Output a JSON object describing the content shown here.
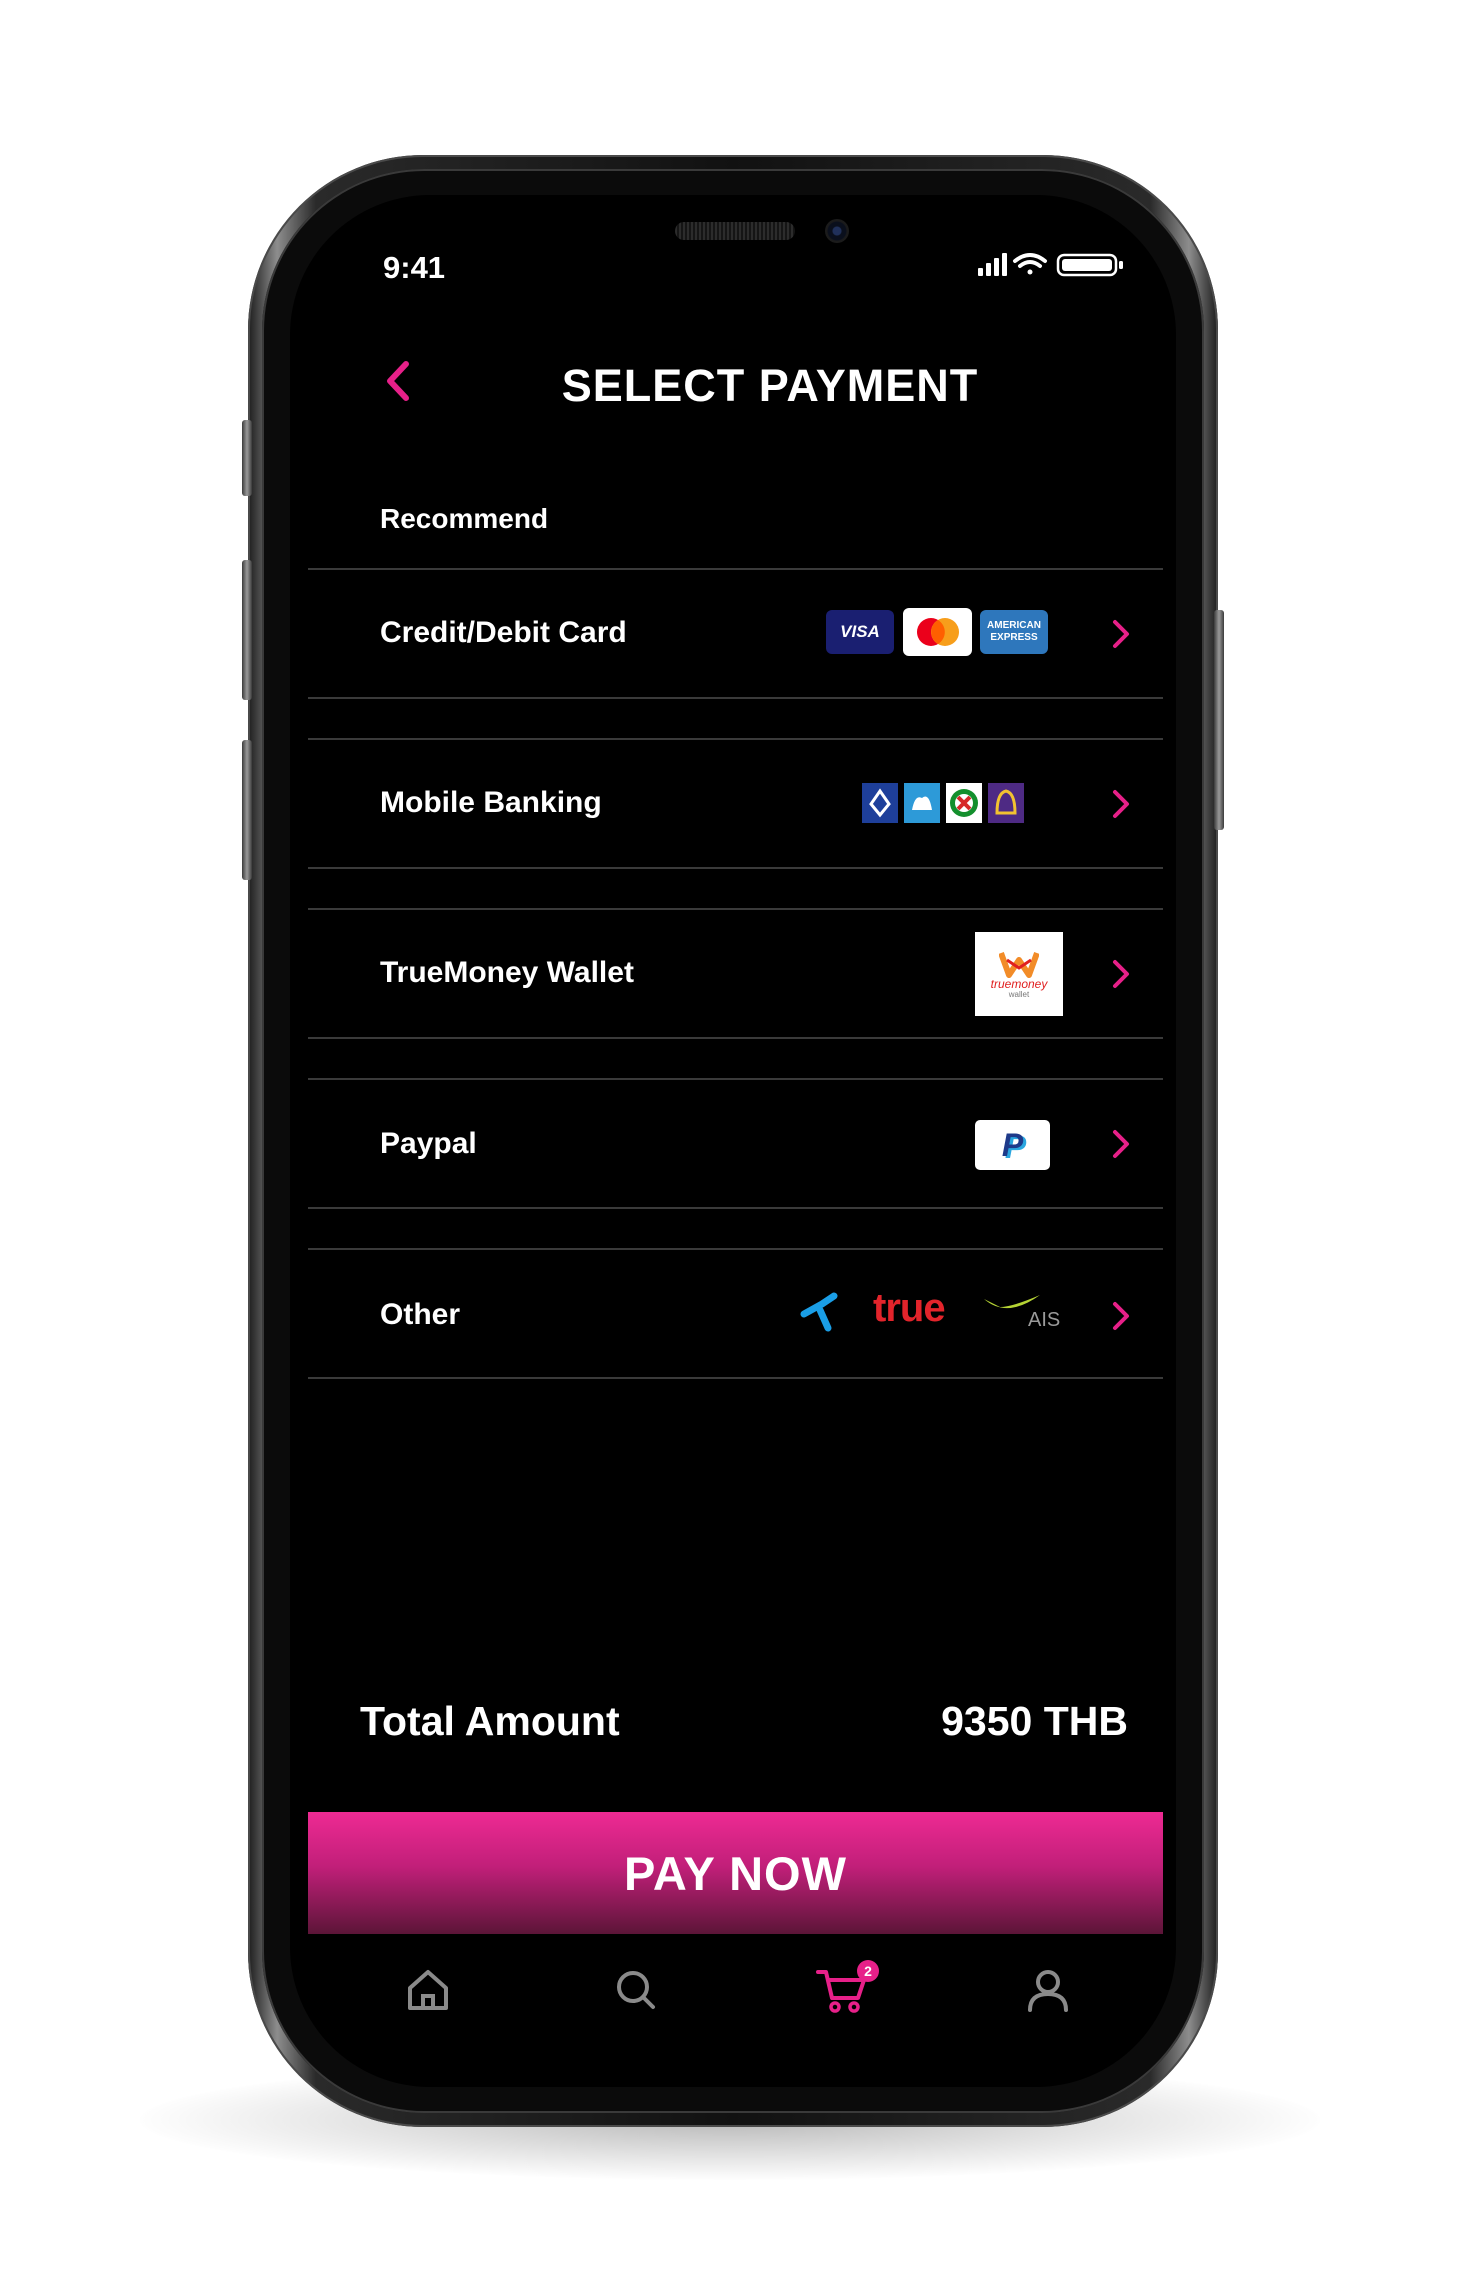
{
  "status_bar": {
    "time": "9:41"
  },
  "header": {
    "title": "SELECT PAYMENT",
    "back_icon": "chevron-left-icon"
  },
  "section": {
    "label": "Recommend"
  },
  "payment_methods": [
    {
      "label": "Credit/Debit Card",
      "logos": [
        "VISA",
        "mastercard",
        "AMERICAN EXPRESS"
      ]
    },
    {
      "label": "Mobile Banking",
      "logos": [
        "bangkok-bank-icon",
        "krungsri-icon",
        "kasikorn-icon",
        "scb-icon"
      ]
    },
    {
      "label": "TrueMoney Wallet",
      "logos": [
        "truemoney wallet"
      ]
    },
    {
      "label": "Paypal",
      "logos": [
        "paypal-icon"
      ]
    },
    {
      "label": "Other",
      "logos": [
        "dtac-icon",
        "true",
        "AIS"
      ]
    }
  ],
  "logo_text": {
    "visa": "VISA",
    "amex_line1": "AMERICAN",
    "amex_line2": "EXPRESS",
    "truemoney_1": "truemoney",
    "truemoney_2": "wallet",
    "paypal": "P",
    "true": "true",
    "ais": "AIS"
  },
  "summary": {
    "label": "Total Amount",
    "value": "9350 THB"
  },
  "pay_button": {
    "label": "PAY NOW"
  },
  "bottom_nav": {
    "items": [
      "home-icon",
      "search-icon",
      "cart-icon",
      "profile-icon"
    ],
    "cart_badge": "2"
  },
  "colors": {
    "accent": "#e72089",
    "background": "#000000",
    "text": "#ffffff",
    "divider": "#3a3a3a"
  }
}
